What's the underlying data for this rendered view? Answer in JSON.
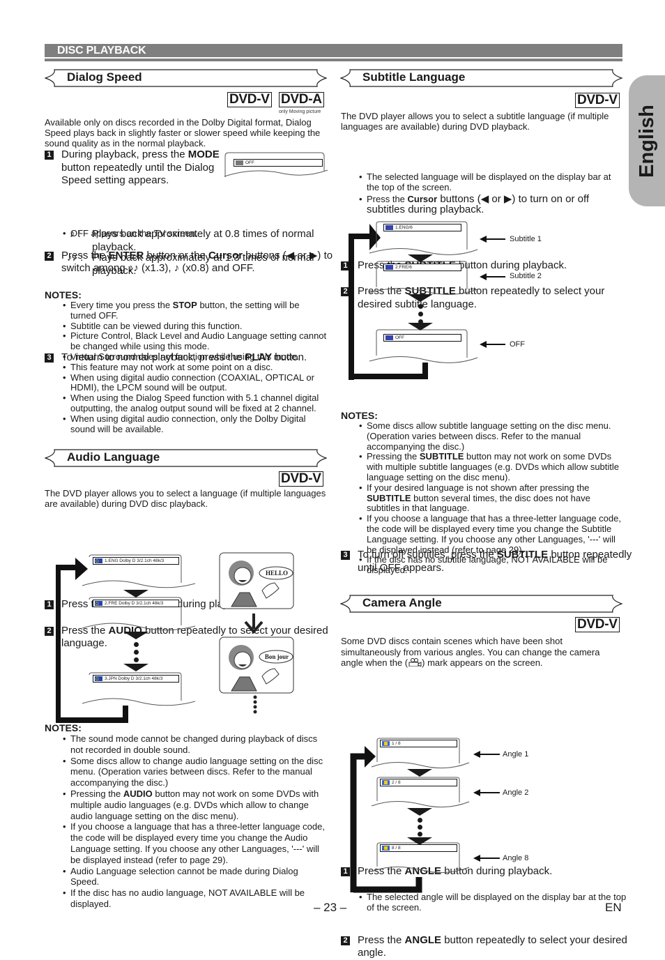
{
  "header": {
    "title": "DISC PLAYBACK"
  },
  "side_tab": {
    "label": "English"
  },
  "footer": {
    "page_number": "– 23 –",
    "lang_code": "EN"
  },
  "dialog_speed": {
    "title": "Dialog Speed",
    "badges": [
      "DVD-V",
      "DVD-A"
    ],
    "badge_note": "only Moving picture",
    "intro": "Available only on discs recorded in the Dolby Digital format, Dialog Speed plays back in slightly faster or slower speed while keeping the sound quality as in the normal playback.",
    "screen_text": "OFF",
    "steps": [
      {
        "num": "1",
        "pre": "During playback, press the ",
        "bold": "MODE",
        "post": " button repeatedly until the Dialog Speed setting appears.",
        "bullet": "OFF appears on the TV screen."
      },
      {
        "num": "2",
        "pre": "Press the ",
        "bold": "ENTER",
        "mid": " button or the ",
        "bold2": "Cursor",
        "post": " buttons (◀ or ▶) to switch among ♪♪ (x1.3), ♪ (x0.8) and OFF."
      },
      {
        "num": "3",
        "pre": "To return to normal playback, press the ",
        "bold": "PLAY",
        "post": " button."
      }
    ],
    "speed_defs": [
      {
        "symbol": "♪ :",
        "text": "Plays back approximately at 0.8 times of normal playback."
      },
      {
        "symbol": "♪♪ :",
        "text": "Plays back approximately at 1.3 times of normal playback."
      }
    ],
    "notes_title": "NOTES:",
    "notes": [
      {
        "pre": "Every time you press the ",
        "bold": "STOP",
        "post": " button, the setting will be turned OFF."
      },
      {
        "pre": "Subtitle can be viewed during this function."
      },
      {
        "pre": "Picture Control, Black Level and Audio Language setting cannot be changed while using this mode."
      },
      {
        "pre": "Virtual Surround does not function while using this mode."
      },
      {
        "pre": "This feature may not work at some point on a disc."
      },
      {
        "pre": "When using digital audio connection (COAXIAL, OPTICAL or HDMI), the LPCM sound will be output."
      },
      {
        "pre": "When using the Dialog Speed function with 5.1 channel digital outputting, the analog output sound will be fixed at 2 channel."
      },
      {
        "pre": "When using digital audio connection, only the Dolby Digital sound will be available."
      }
    ]
  },
  "audio_language": {
    "title": "Audio Language",
    "badge": "DVD-V",
    "intro": "The DVD player allows you to select a language (if multiple languages are available) during DVD disc playback.",
    "steps": [
      {
        "num": "1",
        "pre": "Press the ",
        "bold": "AUDIO",
        "post": " button during playback."
      },
      {
        "num": "2",
        "pre": "Press the ",
        "bold": "AUDIO",
        "post": " button repeatedly to select your desired language."
      }
    ],
    "screens": [
      "1.ENG Dolby D 3/2.1ch 48k/3",
      "2.FRE Dolby D 3/2.1ch 48k/3",
      "3.JPN Dolby D 3/2.1ch 48k/3"
    ],
    "speech": [
      "HELLO",
      "Bon jour"
    ],
    "notes_title": "NOTES:",
    "notes": [
      {
        "pre": "The sound mode cannot be changed during playback of discs not recorded in double sound."
      },
      {
        "pre": "Some discs allow to change audio language setting on the disc menu. (Operation varies between discs. Refer to the manual accompanying the disc.)"
      },
      {
        "pre": "Pressing the ",
        "bold": "AUDIO",
        "post": " button may not work on some DVDs with multiple audio languages (e.g. DVDs which allow to change audio language setting on the disc menu)."
      },
      {
        "pre": "If you choose a language that has a three-letter language code, the code will be displayed every time you change the Audio Language setting. If you choose any other Languages, '---' will be displayed instead (refer to page 29)."
      },
      {
        "pre": "Audio Language selection cannot be made during Dialog Speed."
      },
      {
        "pre": "If the disc has no audio language, NOT AVAILABLE will be displayed."
      }
    ]
  },
  "subtitle_language": {
    "title": "Subtitle Language",
    "badge": "DVD-V",
    "intro": "The DVD player allows you to select a subtitle language (if multiple languages are available) during DVD playback.",
    "steps": [
      {
        "num": "1",
        "pre": "Press the ",
        "bold": "SUBTITLE",
        "post": " button during playback."
      },
      {
        "num": "2",
        "pre": "Press the ",
        "bold": "SUBTITLE",
        "post": " button repeatedly to select your desired subtitle language."
      },
      {
        "num": "3",
        "pre": "To turn off subtitles, press the ",
        "bold": "SUBTITLE",
        "post": " button repeatedly until OFF appears."
      }
    ],
    "step2_bullets": [
      {
        "pre": "The selected language will be displayed on the display bar at the top of the screen."
      },
      {
        "pre": "Press the ",
        "bold": "Cursor",
        "post": " buttons (◀ or ▶) to turn on or off subtitles during playback."
      }
    ],
    "screens": [
      {
        "bar": "1.ENG/6",
        "label": "Subtitle 1"
      },
      {
        "bar": "2.FRE/6",
        "label": "Subtitle 2"
      },
      {
        "bar": "OFF",
        "label": "OFF"
      }
    ],
    "notes_title": "NOTES:",
    "notes": [
      {
        "pre": "Some discs allow subtitle language setting on the disc menu. (Operation varies between discs. Refer to the manual accompanying the disc.)"
      },
      {
        "pre": "Pressing the ",
        "bold": "SUBTITLE",
        "post": " button may not work on some DVDs with multiple subtitle languages (e.g. DVDs which allow subtitle language setting on the disc menu)."
      },
      {
        "pre": "If your desired language is not shown after pressing the ",
        "bold": "SUBTITLE",
        "post": " button several times, the disc does not have subtitles in that language."
      },
      {
        "pre": "If you choose a language that has a three-letter language code, the code will be displayed every time you change the Subtitle Language setting. If you choose any other Languages, '---' will be displayed instead (refer to page 29)."
      },
      {
        "pre": "If the disc has no subtitle language, NOT AVAILABLE will be displayed."
      }
    ]
  },
  "camera_angle": {
    "title": "Camera Angle",
    "badge": "DVD-V",
    "intro_pre": "Some DVD discs contain scenes which have been shot simultaneously from various angles. You can change the camera angle when the (",
    "intro_post": ") mark appears on the screen.",
    "steps": [
      {
        "num": "1",
        "pre": "Press the ",
        "bold": "ANGLE",
        "post": " button during playback.",
        "bullet": "The selected angle will be displayed on the display bar at the top of the screen."
      },
      {
        "num": "2",
        "pre": "Press the ",
        "bold": "ANGLE",
        "post": " button repeatedly to select your desired angle."
      }
    ],
    "screens": [
      {
        "bar": "1 / 8",
        "label": "Angle 1"
      },
      {
        "bar": "2 / 8",
        "label": "Angle 2"
      },
      {
        "bar": "8 / 8",
        "label": "Angle 8"
      }
    ]
  }
}
